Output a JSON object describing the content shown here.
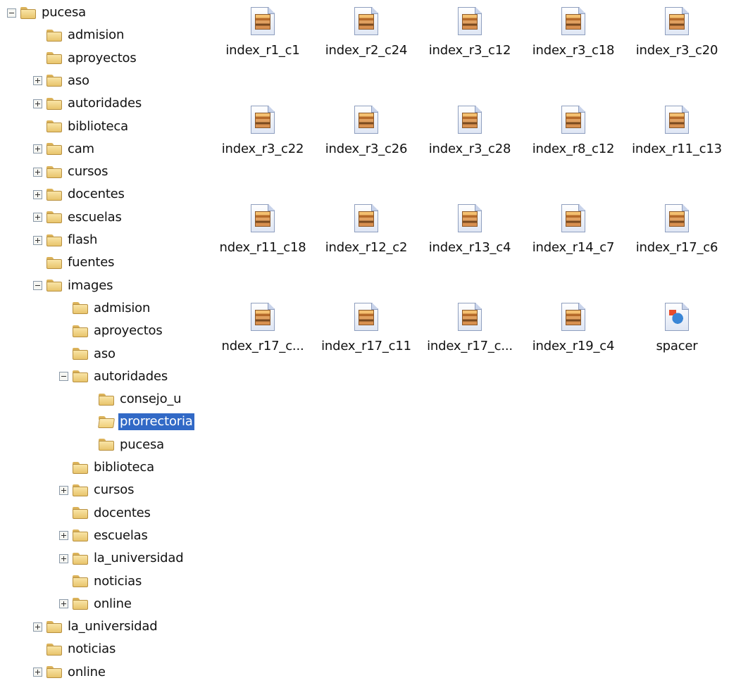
{
  "tree": [
    {
      "label": "pucesa",
      "expander": "minus",
      "indent": 0,
      "open": false
    },
    {
      "label": "admision",
      "expander": "none",
      "indent": 1
    },
    {
      "label": "aproyectos",
      "expander": "none",
      "indent": 1
    },
    {
      "label": "aso",
      "expander": "plus",
      "indent": 1
    },
    {
      "label": "autoridades",
      "expander": "plus",
      "indent": 1
    },
    {
      "label": "biblioteca",
      "expander": "none",
      "indent": 1
    },
    {
      "label": "cam",
      "expander": "plus",
      "indent": 1
    },
    {
      "label": "cursos",
      "expander": "plus",
      "indent": 1
    },
    {
      "label": "docentes",
      "expander": "plus",
      "indent": 1
    },
    {
      "label": "escuelas",
      "expander": "plus",
      "indent": 1
    },
    {
      "label": "flash",
      "expander": "plus",
      "indent": 1
    },
    {
      "label": "fuentes",
      "expander": "none",
      "indent": 1
    },
    {
      "label": "images",
      "expander": "minus",
      "indent": 1
    },
    {
      "label": "admision",
      "expander": "none",
      "indent": 2
    },
    {
      "label": "aproyectos",
      "expander": "none",
      "indent": 2
    },
    {
      "label": "aso",
      "expander": "none",
      "indent": 2
    },
    {
      "label": "autoridades",
      "expander": "minus",
      "indent": 2
    },
    {
      "label": "consejo_u",
      "expander": "none",
      "indent": 3
    },
    {
      "label": "prorrectoria",
      "expander": "none",
      "indent": 3,
      "selected": true,
      "open": true
    },
    {
      "label": "pucesa",
      "expander": "none",
      "indent": 3
    },
    {
      "label": "biblioteca",
      "expander": "none",
      "indent": 2
    },
    {
      "label": "cursos",
      "expander": "plus",
      "indent": 2
    },
    {
      "label": "docentes",
      "expander": "none",
      "indent": 2
    },
    {
      "label": "escuelas",
      "expander": "plus",
      "indent": 2
    },
    {
      "label": "la_universidad",
      "expander": "plus",
      "indent": 2
    },
    {
      "label": "noticias",
      "expander": "none",
      "indent": 2
    },
    {
      "label": "online",
      "expander": "plus",
      "indent": 2
    },
    {
      "label": "la_universidad",
      "expander": "plus",
      "indent": 1
    },
    {
      "label": "noticias",
      "expander": "none",
      "indent": 1
    },
    {
      "label": "online",
      "expander": "plus",
      "indent": 1
    }
  ],
  "files": [
    {
      "name": "index_r1_c1",
      "icon": "image-file-icon"
    },
    {
      "name": "index_r2_c24",
      "icon": "image-file-icon"
    },
    {
      "name": "index_r3_c12",
      "icon": "image-file-icon"
    },
    {
      "name": "index_r3_c18",
      "icon": "image-file-icon"
    },
    {
      "name": "index_r3_c20",
      "icon": "image-file-icon"
    },
    {
      "name": "index_r3_c22",
      "icon": "image-file-icon"
    },
    {
      "name": "index_r3_c26",
      "icon": "image-file-icon"
    },
    {
      "name": "index_r3_c28",
      "icon": "image-file-icon"
    },
    {
      "name": "index_r8_c12",
      "icon": "image-file-icon"
    },
    {
      "name": "index_r11_c13",
      "icon": "image-file-icon"
    },
    {
      "name": "ndex_r11_c18",
      "icon": "image-file-icon"
    },
    {
      "name": "index_r12_c2",
      "icon": "image-file-icon"
    },
    {
      "name": "index_r13_c4",
      "icon": "image-file-icon"
    },
    {
      "name": "index_r14_c7",
      "icon": "image-file-icon"
    },
    {
      "name": "index_r17_c6",
      "icon": "image-file-icon"
    },
    {
      "name": "ndex_r17_c...",
      "icon": "image-file-icon"
    },
    {
      "name": "index_r17_c11",
      "icon": "image-file-icon"
    },
    {
      "name": "index_r17_c...",
      "icon": "image-file-icon"
    },
    {
      "name": "index_r19_c4",
      "icon": "image-file-icon"
    },
    {
      "name": "spacer",
      "icon": "web-image-file-icon"
    }
  ],
  "colors": {
    "selection": "#3169c6",
    "folder": "#f0cf78"
  }
}
